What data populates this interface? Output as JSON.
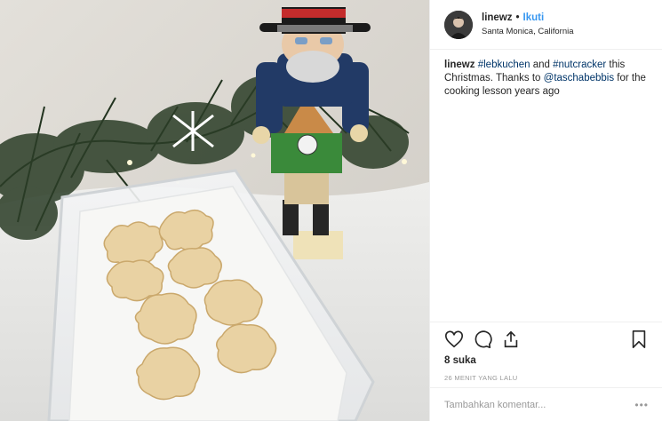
{
  "header": {
    "username": "linewz",
    "separator": "•",
    "follow_label": "Ikuti",
    "location": "Santa Monica, California"
  },
  "caption": {
    "username": "linewz",
    "hashtag1": "#lebkuchen",
    "text1": " and ",
    "hashtag2": "#nutcracker",
    "text2": " this Christmas. Thanks to ",
    "mention": "@taschabebbis",
    "text3": " for the cooking lesson years ago"
  },
  "likes": "8 suka",
  "timestamp": "26 MENIT YANG LALU",
  "comment": {
    "placeholder": "Tambahkan komentar..."
  },
  "icons": {
    "like": "heart-icon",
    "comment": "comment-icon",
    "share": "share-icon",
    "save": "bookmark-icon",
    "more": "more-options-icon"
  },
  "colors": {
    "follow": "#3897f0",
    "link": "#003569",
    "muted": "#999999"
  }
}
